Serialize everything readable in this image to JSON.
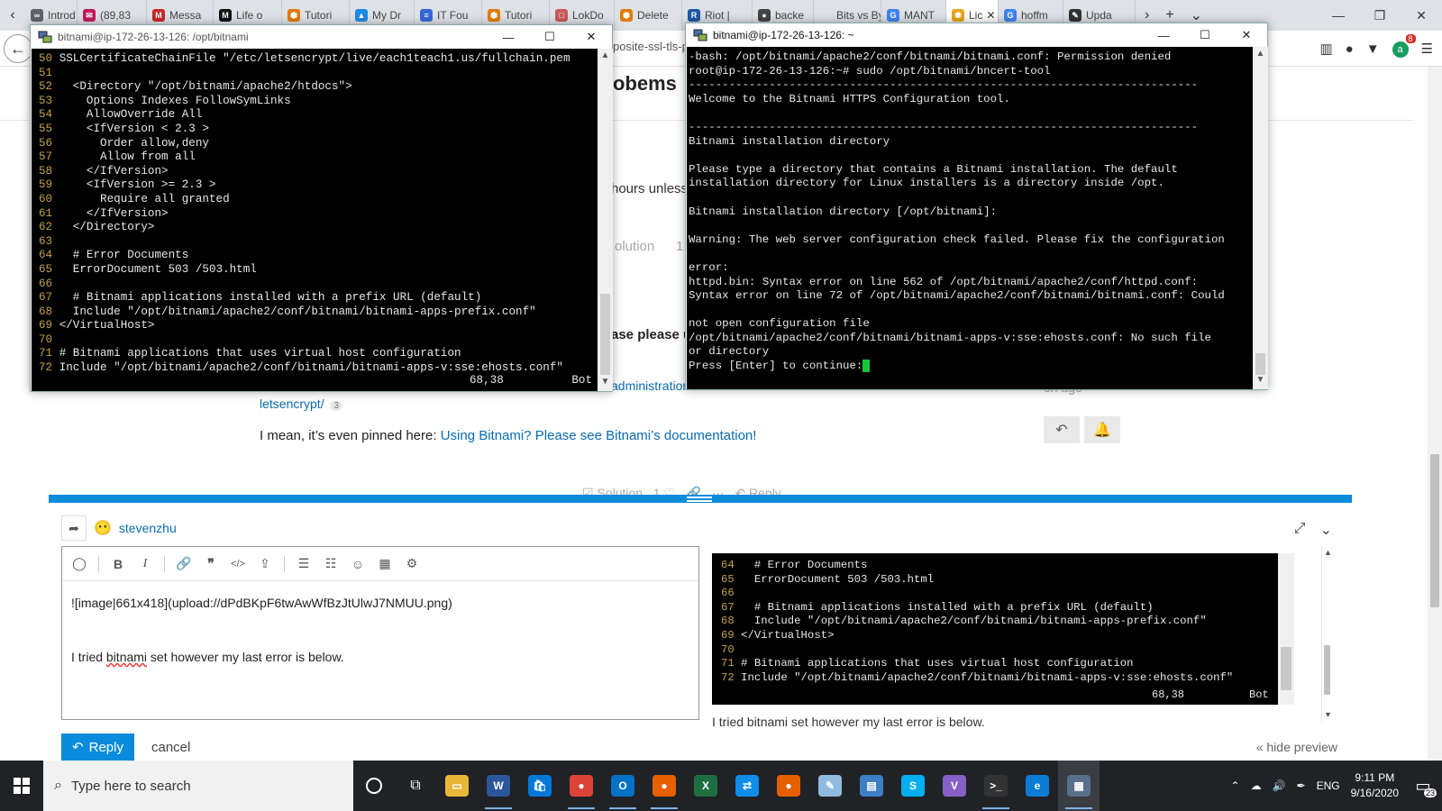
{
  "browser": {
    "tabs": [
      {
        "label": "Introd",
        "color": "#5f6368",
        "glyph": "∞"
      },
      {
        "label": "(89,83",
        "color": "#c2185b",
        "glyph": "✉"
      },
      {
        "label": "Messa",
        "color": "#c62828",
        "glyph": "M"
      },
      {
        "label": "Life o",
        "color": "#111111",
        "glyph": "M"
      },
      {
        "label": "Tutori",
        "color": "#e07b00",
        "glyph": "⬢"
      },
      {
        "label": "My Dr",
        "color": "#1e88e5",
        "glyph": "▲"
      },
      {
        "label": "IT Fou",
        "color": "#3367d6",
        "glyph": "≡"
      },
      {
        "label": "Tutori",
        "color": "#e07b00",
        "glyph": "⬢"
      },
      {
        "label": "LokDo",
        "color": "#c75b5b",
        "glyph": "□"
      },
      {
        "label": "Delete",
        "color": "#e07b00",
        "glyph": "⬢"
      },
      {
        "label": "Riot |",
        "color": "#1e5aa8",
        "glyph": "R"
      },
      {
        "label": "backe",
        "color": "#444444",
        "glyph": "●"
      },
      {
        "label": "Bits vs Byt",
        "color": "#dee1e6",
        "glyph": ""
      },
      {
        "label": "MANT",
        "color": "#4285f4",
        "glyph": "G"
      },
      {
        "label": "Lic",
        "color": "#e6a817",
        "glyph": "✺"
      },
      {
        "label": "hoffm",
        "color": "#4285f4",
        "glyph": "G"
      },
      {
        "label": "Upda",
        "color": "#333333",
        "glyph": "✎"
      }
    ],
    "active_tab_index": 14,
    "extension_badge": "8",
    "partial_url": "posite-ssl-tls-p"
  },
  "page": {
    "title_fragment": "obems",
    "text_hours": "hours unless",
    "text_please": "ase please u",
    "solution_label": "olution",
    "solution_count": "1",
    "link_admin": "administration",
    "link_letsencrypt": "letsencrypt/",
    "letsencrypt_count": "3",
    "time_ago": "on ago",
    "pinned_prefix": "I mean, it’s even pinned here: ",
    "pinned_link": "Using Bitnami? Please see Bitnami’s documentation!",
    "behind_solution": "Solution",
    "behind_count": "1",
    "behind_reply": "Reply"
  },
  "composer": {
    "username": "stevenzhu",
    "editor_line1": "![image|661x418](upload://dPdBKpF6twAwWfBzJtUlwJ7NMUU.png)",
    "editor_line2_before": "I tried ",
    "editor_line2_misspelled": "bitnami",
    "editor_line2_after": " set however my last error is below.",
    "reply_label": "Reply",
    "cancel_label": "cancel",
    "hide_preview_label": "« hide preview",
    "preview_text": "I tried bitnami set however my last error is below.",
    "preview_term_lines": [
      {
        "n": "64",
        "t": "  # Error Documents"
      },
      {
        "n": "65",
        "t": "  ErrorDocument 503 /503.html"
      },
      {
        "n": "66",
        "t": ""
      },
      {
        "n": "67",
        "t": "  # Bitnami applications installed with a prefix URL (default)"
      },
      {
        "n": "68",
        "t": "  Include \"/opt/bitnami/apache2/conf/bitnami/bitnami-apps-prefix.conf\""
      },
      {
        "n": "69",
        "t": "</VirtualHost>"
      },
      {
        "n": "70",
        "t": ""
      },
      {
        "n": "71",
        "t": "# Bitnami applications that uses virtual host configuration"
      },
      {
        "n": "72",
        "t": "Include \"/opt/bitnami/apache2/conf/bitnami/bitnami-apps-v:sse:ehosts.conf\""
      }
    ],
    "preview_status": "68,38          Bot",
    "toolbar_icons": [
      "speech-bubble-icon",
      "bold-icon",
      "italic-icon",
      "link-icon",
      "quote-icon",
      "code-icon",
      "upload-icon",
      "bullet-list-icon",
      "numbered-list-icon",
      "emoji-icon",
      "calendar-icon",
      "gear-icon"
    ]
  },
  "terminal_left": {
    "title": "bitnami@ip-172-26-13-126: /opt/bitnami",
    "lines": [
      {
        "n": "50",
        "t": "SSLCertificateChainFile \"/etc/letsencrypt/live/each1teach1.us/fullchain.pem"
      },
      {
        "n": "51",
        "t": ""
      },
      {
        "n": "52",
        "t": "  <Directory \"/opt/bitnami/apache2/htdocs\">"
      },
      {
        "n": "53",
        "t": "    Options Indexes FollowSymLinks"
      },
      {
        "n": "54",
        "t": "    AllowOverride All"
      },
      {
        "n": "55",
        "t": "    <IfVersion < 2.3 >"
      },
      {
        "n": "56",
        "t": "      Order allow,deny"
      },
      {
        "n": "57",
        "t": "      Allow from all"
      },
      {
        "n": "58",
        "t": "    </IfVersion>"
      },
      {
        "n": "59",
        "t": "    <IfVersion >= 2.3 >"
      },
      {
        "n": "60",
        "t": "      Require all granted"
      },
      {
        "n": "61",
        "t": "    </IfVersion>"
      },
      {
        "n": "62",
        "t": "  </Directory>"
      },
      {
        "n": "63",
        "t": ""
      },
      {
        "n": "64",
        "t": "  # Error Documents"
      },
      {
        "n": "65",
        "t": "  ErrorDocument 503 /503.html"
      },
      {
        "n": "66",
        "t": ""
      },
      {
        "n": "67",
        "t": "  # Bitnami applications installed with a prefix URL (default)"
      },
      {
        "n": "68",
        "t": "  Include \"/opt/bitnami/apache2/conf/bitnami/bitnami-apps-prefix.conf\""
      },
      {
        "n": "69",
        "t": "</VirtualHost>"
      },
      {
        "n": "70",
        "t": ""
      },
      {
        "n": "71",
        "t": "# Bitnami applications that uses virtual host configuration"
      },
      {
        "n": "72",
        "t": "Include \"/opt/bitnami/apache2/conf/bitnami/bitnami-apps-v:sse:ehosts.conf\""
      }
    ],
    "status": "68,38          Bot"
  },
  "terminal_right": {
    "title": "bitnami@ip-172-26-13-126: ~",
    "lines": [
      "-bash: /opt/bitnami/apache2/conf/bitnami/bitnami.conf: Permission denied",
      "root@ip-172-26-13-126:~# sudo /opt/bitnami/bncert-tool",
      "----------------------------------------------------------------------------",
      "Welcome to the Bitnami HTTPS Configuration tool.",
      "",
      "----------------------------------------------------------------------------",
      "Bitnami installation directory",
      "",
      "Please type a directory that contains a Bitnami installation. The default",
      "installation directory for Linux installers is a directory inside /opt.",
      "",
      "Bitnami installation directory [/opt/bitnami]:",
      "",
      "Warning: The web server configuration check failed. Please fix the configuration",
      "",
      "error:",
      "httpd.bin: Syntax error on line 562 of /opt/bitnami/apache2/conf/httpd.conf:",
      "Syntax error on line 72 of /opt/bitnami/apache2/conf/bitnami/bitnami.conf: Could",
      "",
      "not open configuration file",
      "/opt/bitnami/apache2/conf/bitnami/bitnami-apps-v:sse:ehosts.conf: No such file",
      "or directory"
    ],
    "prompt": "Press [Enter] to continue:"
  },
  "taskbar": {
    "search_placeholder": "Type here to search",
    "apps": [
      {
        "name": "file-explorer",
        "color": "#e8b73a",
        "glyph": "▭"
      },
      {
        "name": "word",
        "color": "#2b579a",
        "glyph": "W"
      },
      {
        "name": "store",
        "color": "#0078d7",
        "glyph": "🛍"
      },
      {
        "name": "chrome",
        "color": "#db4437",
        "glyph": "●"
      },
      {
        "name": "outlook",
        "color": "#0072c6",
        "glyph": "O"
      },
      {
        "name": "firefox",
        "color": "#e66000",
        "glyph": "●"
      },
      {
        "name": "excel",
        "color": "#1d6f42",
        "glyph": "X"
      },
      {
        "name": "teamviewer",
        "color": "#0e8ee9",
        "glyph": "⇄"
      },
      {
        "name": "firefox-2",
        "color": "#e66000",
        "glyph": "●"
      },
      {
        "name": "notepad",
        "color": "#8fbbe0",
        "glyph": "✎"
      },
      {
        "name": "remote-desktop",
        "color": "#3d7fc4",
        "glyph": "▤"
      },
      {
        "name": "skype",
        "color": "#00aff0",
        "glyph": "S"
      },
      {
        "name": "visual-studio",
        "color": "#8661c5",
        "glyph": "V"
      },
      {
        "name": "terminal",
        "color": "#333333",
        "glyph": ">_"
      },
      {
        "name": "edge",
        "color": "#0c7cd5",
        "glyph": "e"
      },
      {
        "name": "putty",
        "color": "#5a6f8a",
        "glyph": "▦"
      }
    ],
    "language": "ENG",
    "time": "9:11 PM",
    "date": "9/16/2020",
    "notification_count": "23"
  }
}
